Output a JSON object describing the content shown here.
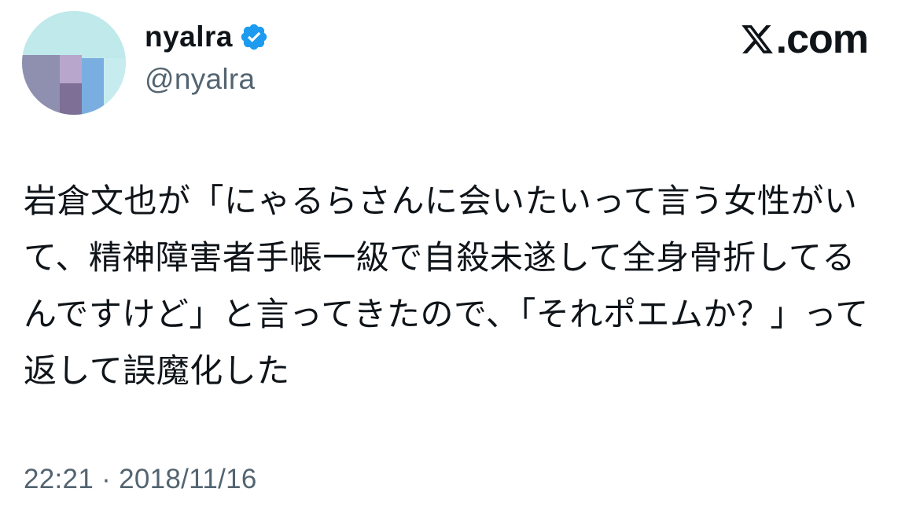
{
  "author": {
    "display_name": "nyalra",
    "handle": "@nyalra",
    "verified_color": "#1d9bf0"
  },
  "brand": {
    "text": ".com",
    "icon": "x-logo-icon"
  },
  "tweet": {
    "text": "岩倉文也が「にゃるらさんに会いたいって言う女性がいて、精神障害者手帳一級で自殺未遂して全身骨折してるんですけど」と言ってきたので、「それポエムか？」って返して誤魔化した",
    "timestamp": "22:21 · 2018/11/16"
  },
  "colors": {
    "text_primary": "#0f1419",
    "text_secondary": "#536471",
    "accent": "#1d9bf0",
    "background": "#ffffff"
  }
}
